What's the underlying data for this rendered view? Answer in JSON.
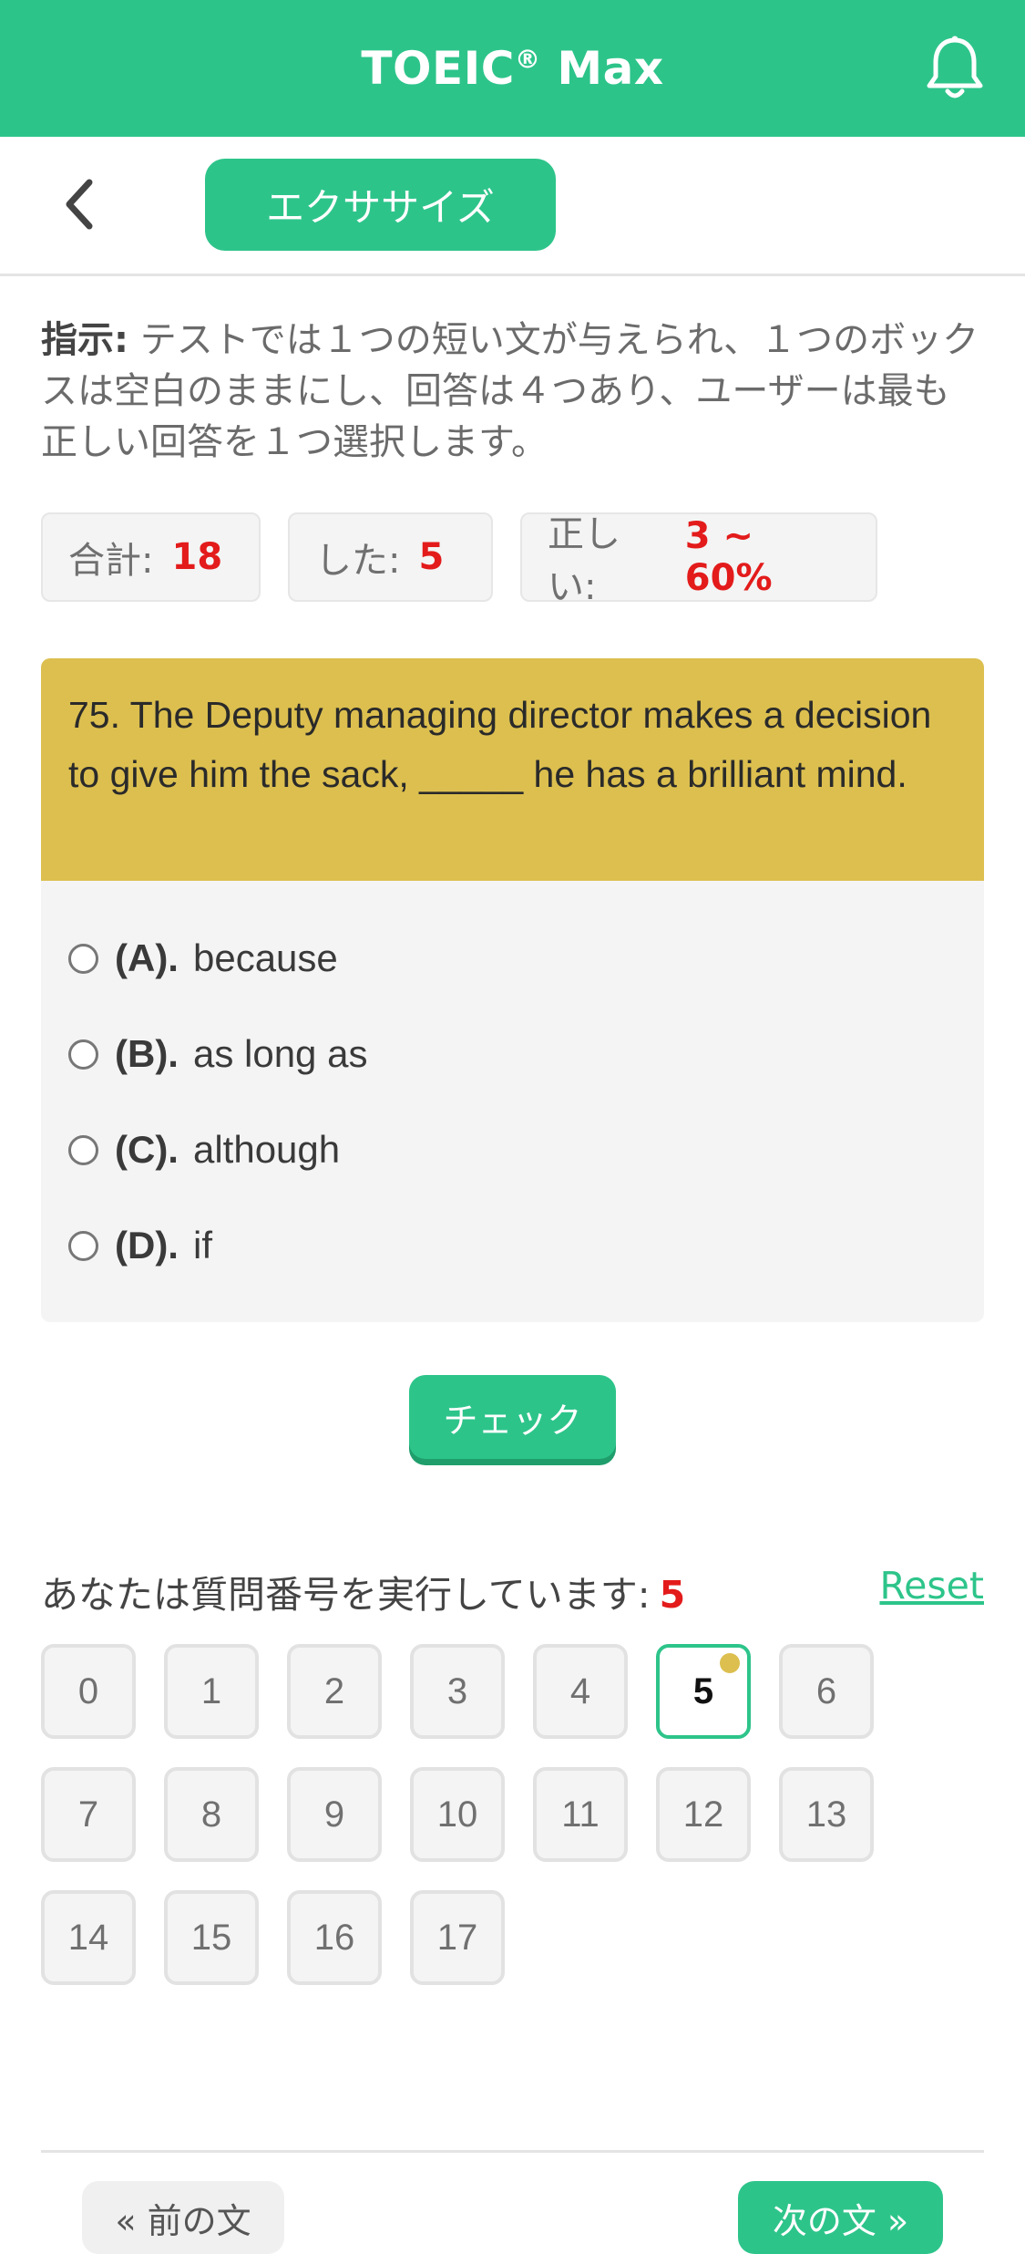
{
  "header": {
    "title": "TOEIC",
    "title_reg": "®",
    "title_suffix": " Max",
    "bell_icon": "bell-icon"
  },
  "subheader": {
    "back_icon": "chevron-left-icon",
    "tab_label": "エクササイズ"
  },
  "instructions": {
    "label": "指示:",
    "text": " テストでは１つの短い文が与えられ、１つのボックスは空白のままにし、回答は４つあり、ユーザーは最も正しい回答を１つ選択します。"
  },
  "stats": {
    "total_label": "合計:",
    "total_value": "18",
    "done_label": "した:",
    "done_value": "5",
    "correct_label": "正しい:",
    "correct_value": "3 ~ 60%"
  },
  "question": {
    "text": "75. The Deputy managing director makes a decision to give him the sack, _____ he has a brilliant mind.",
    "options": [
      {
        "label": "(A).",
        "text": "because"
      },
      {
        "label": "(B).",
        "text": "as long as"
      },
      {
        "label": "(C).",
        "text": "although"
      },
      {
        "label": "(D).",
        "text": "if"
      }
    ]
  },
  "check_label": "チェック",
  "progress": {
    "label": "あなたは質問番号を実行しています:",
    "current": "5",
    "reset_label": "Reset"
  },
  "numbers": [
    "0",
    "1",
    "2",
    "3",
    "4",
    "5",
    "6",
    "7",
    "8",
    "9",
    "10",
    "11",
    "12",
    "13",
    "14",
    "15",
    "16",
    "17"
  ],
  "nav": {
    "prev_label": "« 前の文",
    "next_label": "次の文 »"
  },
  "colors": {
    "accent": "#2dc48a",
    "question_bg": "#dcbf4f",
    "highlight_red": "#e31b1b"
  }
}
